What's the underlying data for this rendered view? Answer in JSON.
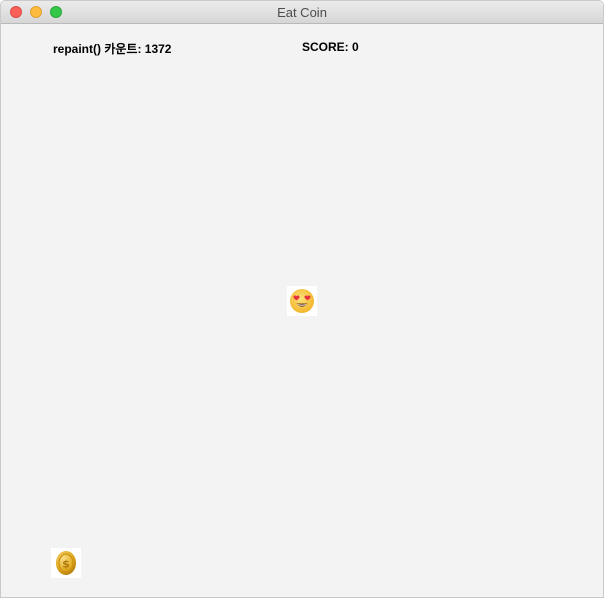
{
  "window": {
    "title": "Eat Coin"
  },
  "hud": {
    "repaint_label": "repaint() 카운트: 1372",
    "score_label": "SCORE: 0"
  },
  "sprites": {
    "player_icon": "heart-eyes-emoji-icon",
    "coin_icon": "gold-coin-icon"
  },
  "colors": {
    "background": "#f3f3f3",
    "emoji_face": "#f7c531",
    "heart": "#e8313f",
    "coin": "#e2a91c"
  }
}
